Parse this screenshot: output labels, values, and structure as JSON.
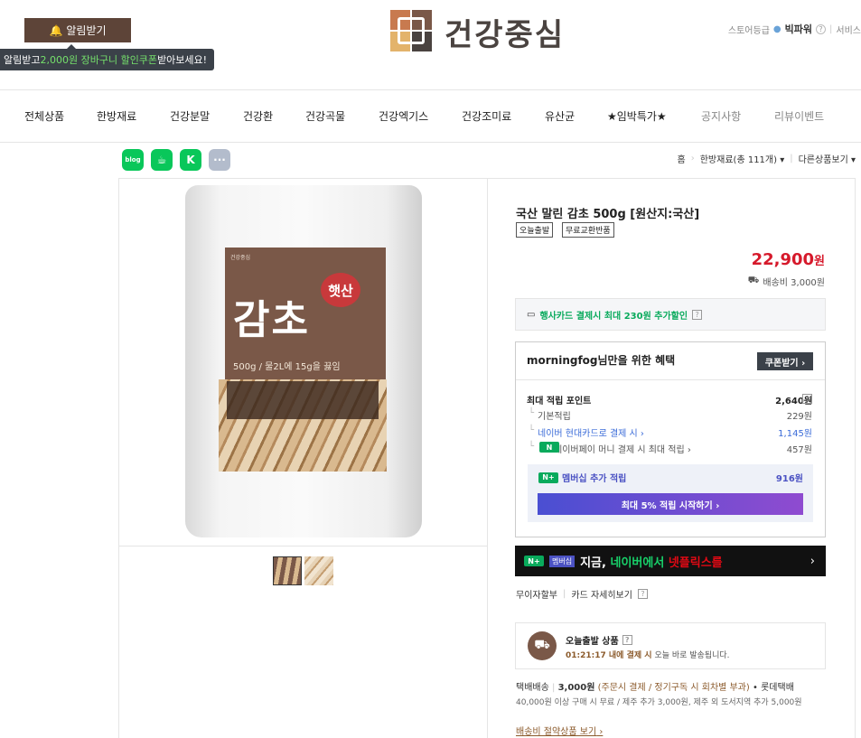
{
  "header": {
    "alarm_label": "알림받기",
    "tip": {
      "pre": "알림받고 ",
      "highlight": "2,000원 장바구니 할인쿠폰",
      "post": " 받아보세요!"
    },
    "logo_text": "건강중심",
    "store_grade_label": "스토어등급",
    "store_grade": "빅파워",
    "service_label": "서비스"
  },
  "nav": {
    "items": [
      "전체상품",
      "한방재료",
      "건강분말",
      "건강환",
      "건강곡물",
      "건강엑기스",
      "건강조미료",
      "유산균",
      "★임박특가★",
      "공지사항",
      "리뷰이벤트"
    ]
  },
  "share": {
    "blog": "blog",
    "cafe": "cafe",
    "talk": "K",
    "more": "···"
  },
  "breadcrumb": {
    "home": "홈",
    "category": "한방재료",
    "count": "(총 111개)",
    "other": "다른상품보기"
  },
  "product": {
    "label_brand": "건강중심",
    "label_title": "감초",
    "label_stamp": "햇산",
    "label_sub": "500g / 물2L에 15g을 끓임",
    "title": "국산 말린 감초 500g [원산지:국산]",
    "tags": [
      "오늘출발",
      "무료교환반품"
    ],
    "price": "22,900",
    "price_unit": "원",
    "shipping": "배송비 3,000원"
  },
  "card_promo": {
    "text": "행사카드 결제시 최대 230원 추가할인",
    "q": "?"
  },
  "benefit": {
    "title": "morningfog님만을 위한 혜택",
    "coupon_btn": "쿠폰받기 ›",
    "max_label": "최대 적립 포인트",
    "max_value": "2,640원",
    "rows": [
      {
        "label": "기본적립",
        "value": "229원"
      },
      {
        "label": "네이버 현대카드로 결제 시 ›",
        "value": "1,145원"
      },
      {
        "label": "네이버페이 머니 결제 시 최대 적립 ›",
        "value": "457원"
      }
    ],
    "member_label": "멤버십 추가 적립",
    "member_value": "916원",
    "member_btn": "최대 5% 적립 시작하기 ›"
  },
  "netflix": {
    "badge": "멤버십",
    "w": "지금, ",
    "g": "네이버에서 ",
    "r": "넷플릭스를"
  },
  "installment": {
    "a": "무이자할부",
    "b": "카드 자세히보기"
  },
  "today": {
    "title": "오늘출발 상품",
    "time": "01:21:17 내에 결제 시",
    "desc": " 오늘 바로 발송됩니다."
  },
  "shipping_info": {
    "type": "택배배송",
    "fee": "3,000원",
    "fee_note": "(주문시 결제 / 정기구독 시 회차별 부과)",
    "carrier": "• 롯데택배",
    "desc": "40,000원 이상 구매 시 무료 / 제주 추가 3,000원, 제주 외 도서지역 추가 5,000원",
    "link": "배송비 절약상품 보기"
  },
  "colors": {
    "brand": "#5d4438",
    "price": "#d6192b",
    "naver": "#09aa5c",
    "member": "#4b52c3"
  }
}
